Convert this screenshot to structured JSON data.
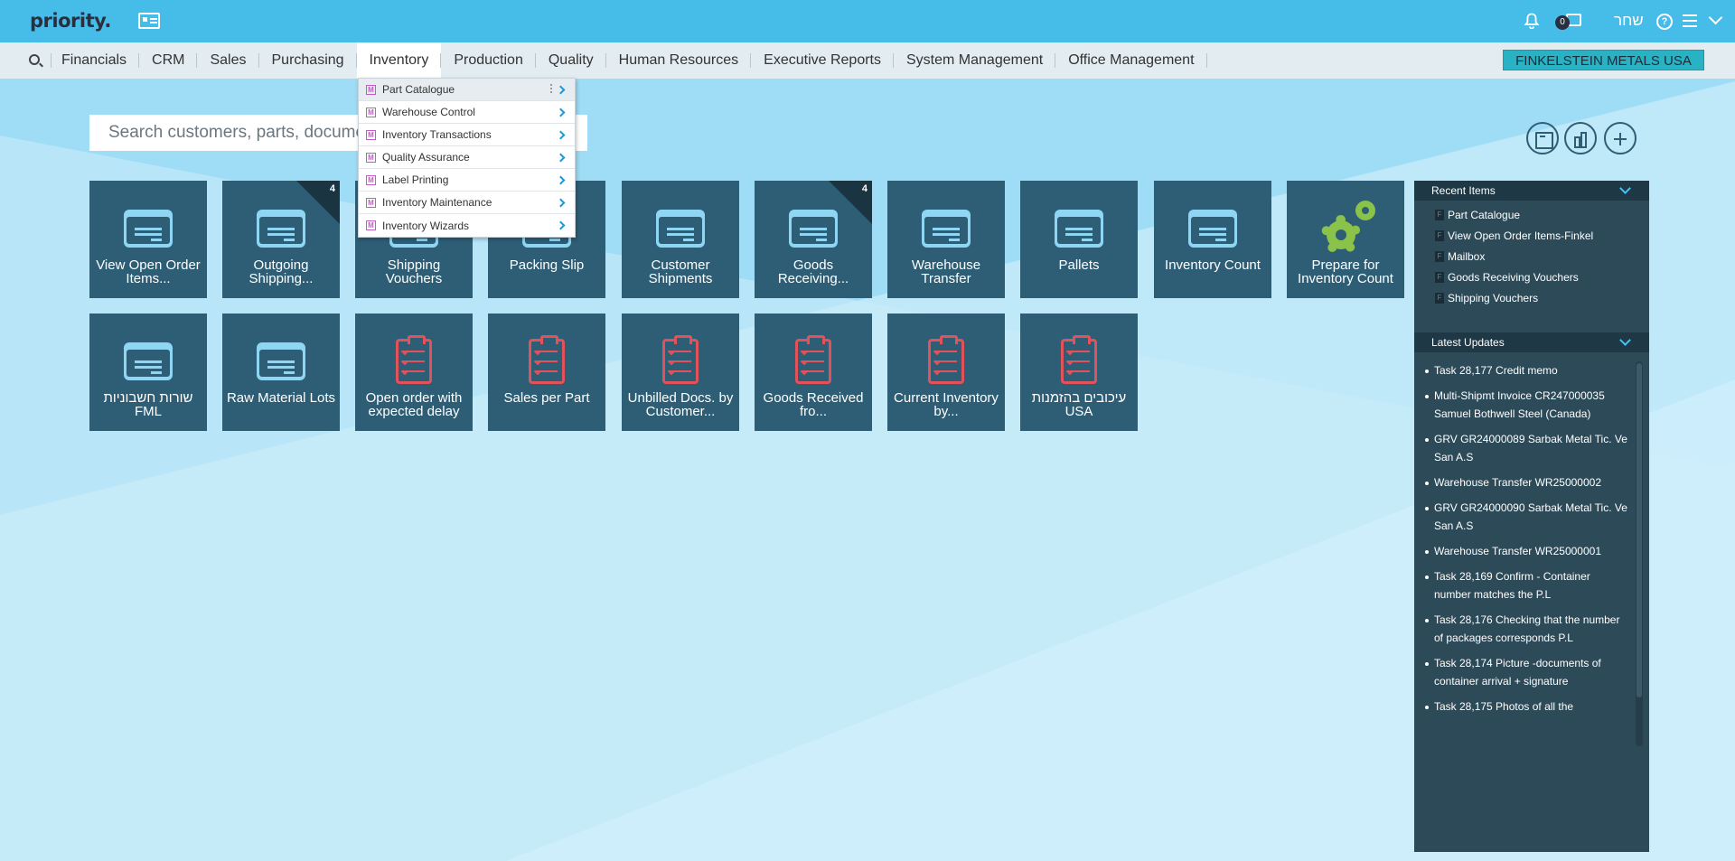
{
  "app": {
    "logo": "priority.",
    "user": "שחר",
    "notifications_count": "0",
    "company": "FINKELSTEIN METALS USA"
  },
  "nav": {
    "items": [
      "Financials",
      "CRM",
      "Sales",
      "Purchasing",
      "Inventory",
      "Production",
      "Quality",
      "Human Resources",
      "Executive Reports",
      "System Management",
      "Office Management"
    ],
    "active": "Inventory"
  },
  "dropdown": {
    "items": [
      {
        "icon": "M",
        "label": "Part Catalogue"
      },
      {
        "icon": "M",
        "label": "Warehouse Control"
      },
      {
        "icon": "M",
        "label": "Inventory Transactions"
      },
      {
        "icon": "M",
        "label": "Quality Assurance"
      },
      {
        "icon": "M",
        "label": "Label Printing"
      },
      {
        "icon": "M",
        "label": "Inventory Maintenance"
      },
      {
        "icon": "M",
        "label": "Inventory Wizards"
      }
    ]
  },
  "search": {
    "placeholder": "Search customers, parts, documents..."
  },
  "tiles": {
    "row1": [
      {
        "label": "View Open Order Items...",
        "icon": "form-icon"
      },
      {
        "label": "Outgoing Shipping...",
        "icon": "form-icon",
        "badge": "4"
      },
      {
        "label": "Shipping Vouchers",
        "icon": "form-icon"
      },
      {
        "label": "Packing Slip",
        "icon": "form-icon"
      },
      {
        "label": "Customer Shipments",
        "icon": "form-icon"
      },
      {
        "label": "Goods Receiving...",
        "icon": "form-icon",
        "badge": "4"
      },
      {
        "label": "Warehouse Transfer",
        "icon": "form-icon"
      },
      {
        "label": "Pallets",
        "icon": "form-icon"
      },
      {
        "label": "Inventory Count",
        "icon": "form-icon"
      },
      {
        "label": "Prepare for Inventory Count",
        "icon": "gears-icon"
      }
    ],
    "row2": [
      {
        "label": "שורות חשבוניות FML",
        "icon": "form-icon"
      },
      {
        "label": "Raw Material Lots",
        "icon": "form-icon"
      },
      {
        "label": "Open order with expected delay",
        "icon": "report-icon"
      },
      {
        "label": "Sales per Part",
        "icon": "report-icon"
      },
      {
        "label": "Unbilled Docs. by Customer...",
        "icon": "report-icon"
      },
      {
        "label": "Goods Received fro...",
        "icon": "report-icon"
      },
      {
        "label": "Current Inventory by...",
        "icon": "report-icon"
      },
      {
        "label": "עיכובים בהזמנות USA",
        "icon": "report-icon"
      }
    ]
  },
  "panel": {
    "recent_title": "Recent Items",
    "recent": [
      {
        "type": "F",
        "label": "Part Catalogue"
      },
      {
        "type": "F",
        "label": "View Open Order Items-Finkel"
      },
      {
        "type": "F",
        "label": "Mailbox"
      },
      {
        "type": "F",
        "label": "Goods Receiving Vouchers"
      },
      {
        "type": "F",
        "label": "Shipping Vouchers"
      }
    ],
    "updates_title": "Latest Updates",
    "updates": [
      "Task 28,177 Credit memo",
      "Multi-Shipmt Invoice CR247000035 Samuel Bothwell Steel (Canada)",
      "GRV GR24000089 Sarbak Metal Tic. Ve San A.S",
      "Warehouse Transfer WR25000002",
      "GRV GR24000090 Sarbak Metal Tic. Ve San A.S",
      "Warehouse Transfer WR25000001",
      "Task 28,169 Confirm - Container number matches the P.L",
      "Task 28,176 Checking that the number of packages corresponds P.L",
      "Task 28,174 Picture -documents of container arrival + signature",
      "Task 28,175 Photos of all the"
    ]
  }
}
